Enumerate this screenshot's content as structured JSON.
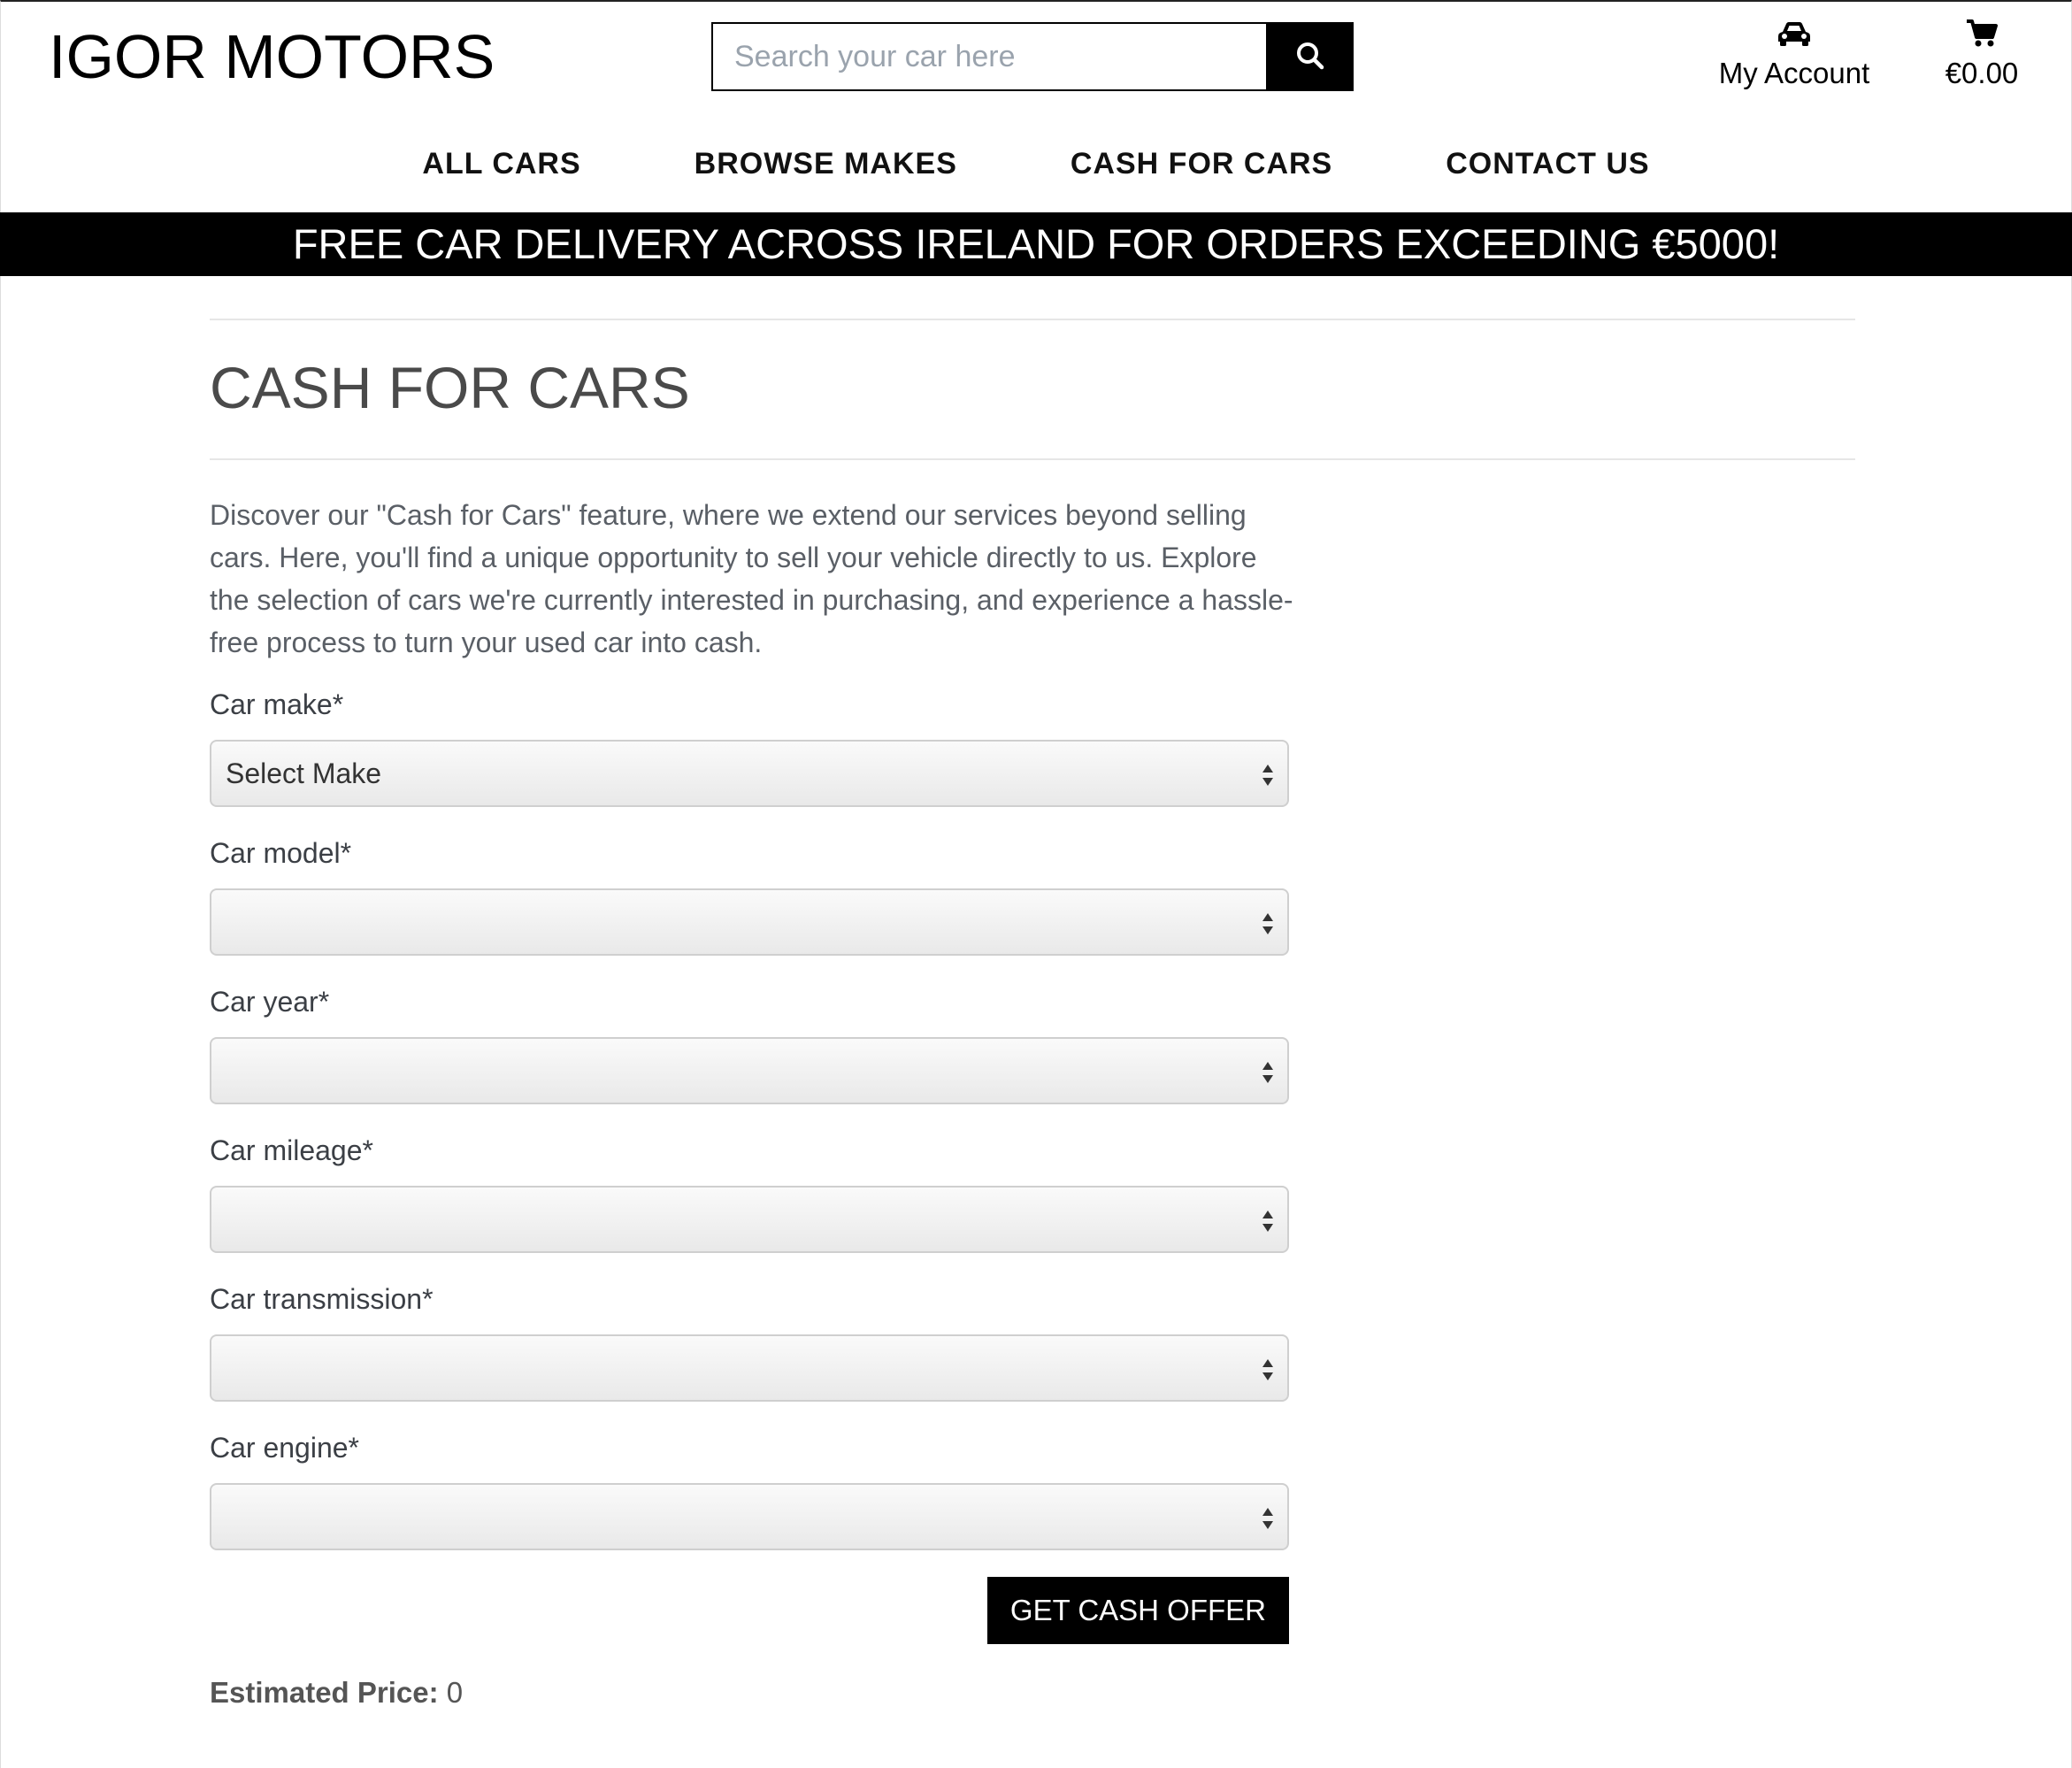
{
  "header": {
    "logo": "IGOR MOTORS",
    "search_placeholder": "Search your car here",
    "account_label": "My Account",
    "cart_total": "€0.00"
  },
  "nav": {
    "items": [
      "ALL CARS",
      "BROWSE MAKES",
      "CASH FOR CARS",
      "CONTACT US"
    ]
  },
  "banner": {
    "text": "FREE CAR DELIVERY ACROSS IRELAND FOR ORDERS EXCEEDING €5000!"
  },
  "main": {
    "title": "CASH FOR CARS",
    "intro": "Discover our \"Cash for Cars\" feature, where we extend our services beyond selling cars. Here, you'll find a unique opportunity to sell your vehicle directly to us. Explore the selection of cars we're currently interested in purchasing, and experience a hassle-free process to turn your used car into cash."
  },
  "form": {
    "fields": [
      {
        "label": "Car make*",
        "value": "Select Make"
      },
      {
        "label": "Car model*",
        "value": ""
      },
      {
        "label": "Car year*",
        "value": ""
      },
      {
        "label": "Car mileage*",
        "value": ""
      },
      {
        "label": "Car transmission*",
        "value": ""
      },
      {
        "label": "Car engine*",
        "value": ""
      }
    ],
    "submit_label": "GET CASH OFFER",
    "estimate_label": "Estimated Price:",
    "estimate_value": "0"
  },
  "icons": {
    "search": "search-icon",
    "account": "car-icon",
    "cart": "cart-icon"
  },
  "colors": {
    "banner_bg": "#000000",
    "button_bg": "#000000",
    "title_text": "#4a4a4a"
  }
}
